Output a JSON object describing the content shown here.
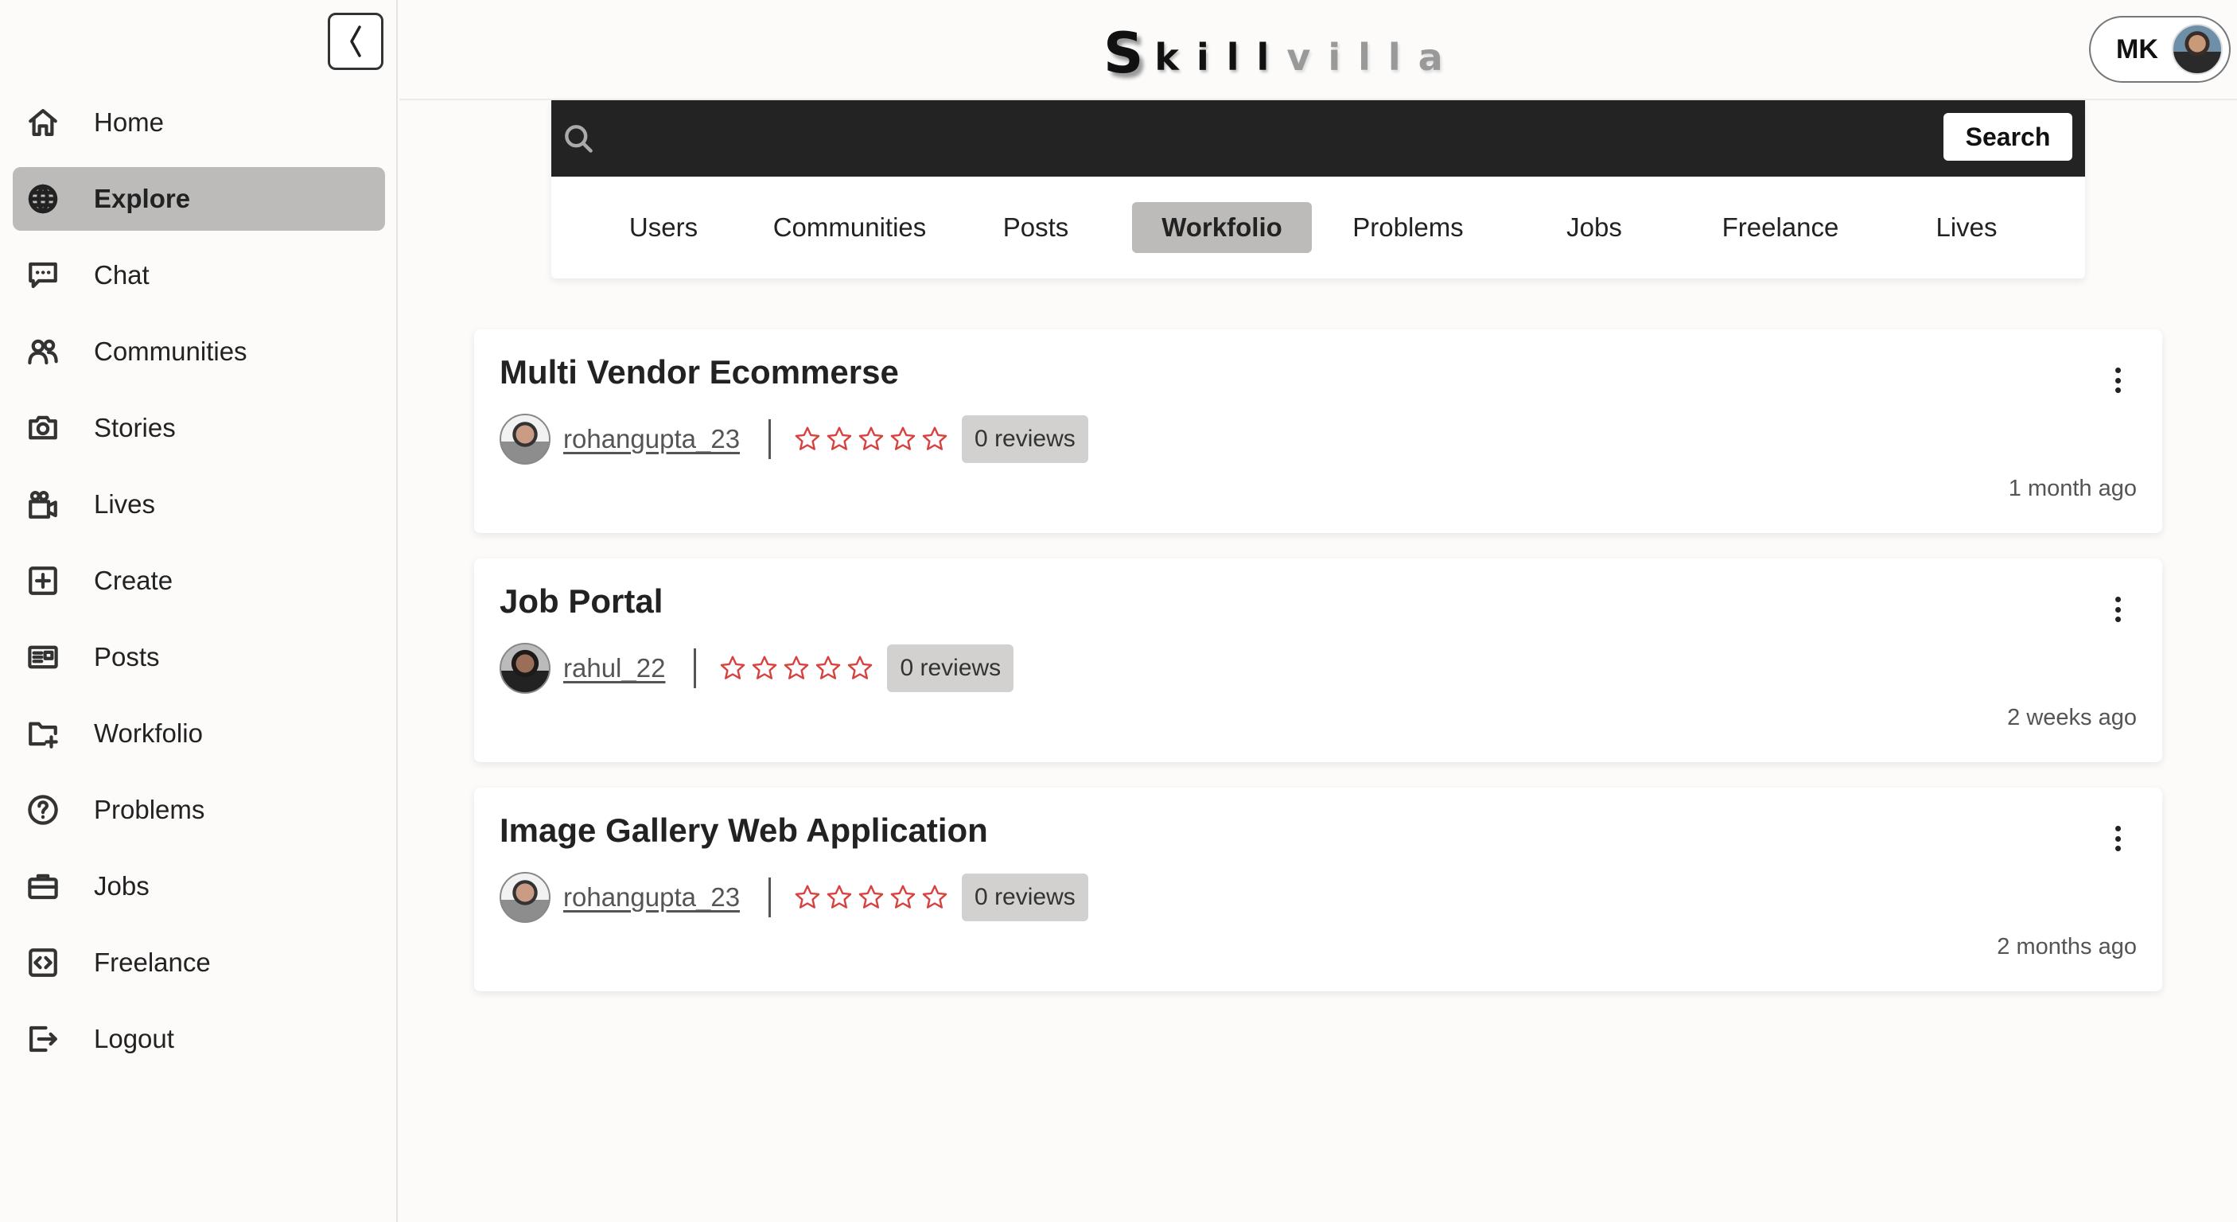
{
  "app": {
    "logo_first": "S",
    "logo_dark": "kill",
    "logo_light": "villa"
  },
  "header": {
    "user_initials": "MK"
  },
  "sidebar": {
    "items": [
      {
        "label": "Home",
        "icon": "home-icon",
        "active": false
      },
      {
        "label": "Explore",
        "icon": "globe-icon",
        "active": true
      },
      {
        "label": "Chat",
        "icon": "chat-icon",
        "active": false
      },
      {
        "label": "Communities",
        "icon": "users-icon",
        "active": false
      },
      {
        "label": "Stories",
        "icon": "camera-icon",
        "active": false
      },
      {
        "label": "Lives",
        "icon": "video-icon",
        "active": false
      },
      {
        "label": "Create",
        "icon": "plus-square-icon",
        "active": false
      },
      {
        "label": "Posts",
        "icon": "newspaper-icon",
        "active": false
      },
      {
        "label": "Workfolio",
        "icon": "folder-plus-icon",
        "active": false
      },
      {
        "label": "Problems",
        "icon": "question-circle-icon",
        "active": false
      },
      {
        "label": "Jobs",
        "icon": "briefcase-icon",
        "active": false
      },
      {
        "label": "Freelance",
        "icon": "code-icon",
        "active": false
      },
      {
        "label": "Logout",
        "icon": "logout-icon",
        "active": false
      }
    ]
  },
  "search": {
    "placeholder": "",
    "value": "",
    "button_label": "Search"
  },
  "tabs": [
    {
      "label": "Users",
      "active": false
    },
    {
      "label": "Communities",
      "active": false
    },
    {
      "label": "Posts",
      "active": false
    },
    {
      "label": "Workfolio",
      "active": true
    },
    {
      "label": "Problems",
      "active": false
    },
    {
      "label": "Jobs",
      "active": false
    },
    {
      "label": "Freelance",
      "active": false
    },
    {
      "label": "Lives",
      "active": false
    }
  ],
  "workfolios": [
    {
      "title": "Multi Vendor Ecommerse",
      "author": "rohangupta_23",
      "rating": 0,
      "reviews": "0 reviews",
      "time": "1 month ago"
    },
    {
      "title": "Job Portal",
      "author": "rahul_22",
      "rating": 0,
      "reviews": "0 reviews",
      "time": "2 weeks ago"
    },
    {
      "title": "Image Gallery Web Application",
      "author": "rohangupta_23",
      "rating": 0,
      "reviews": "0 reviews",
      "time": "2 months ago"
    }
  ],
  "colors": {
    "active_bg": "#bcbbba",
    "search_bar_bg": "#232323",
    "star_color": "#d9413f",
    "page_bg": "#fcfbfa"
  }
}
